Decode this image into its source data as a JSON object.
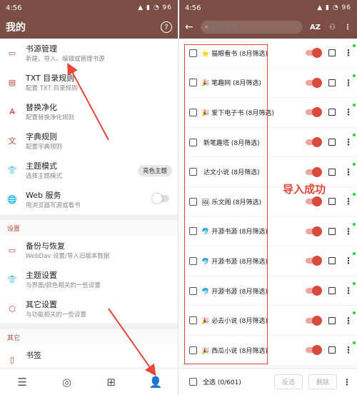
{
  "left": {
    "status_time": "4:56",
    "status_icons": "▲ ▮ ◔ 96",
    "title": "我的",
    "help": "?",
    "items": [
      {
        "title": "书源管理",
        "sub": "新建、导入、编辑或管理书源",
        "icon": "book-icon",
        "glyph": "▭"
      },
      {
        "title": "TXT 目录规则",
        "sub": "配置 TXT 目录规则",
        "icon": "txt-rule-icon",
        "glyph": "▤"
      },
      {
        "title": "替换净化",
        "sub": "配置替换净化规则",
        "icon": "replace-icon",
        "glyph": "A̶"
      },
      {
        "title": "字典规则",
        "sub": "配置字典规则",
        "icon": "dictionary-icon",
        "glyph": "文"
      },
      {
        "title": "主题模式",
        "sub": "选择主题模式",
        "icon": "theme-mode-icon",
        "glyph": "👕",
        "pill": "亮色主题"
      },
      {
        "title": "Web 服务",
        "sub": "用浏览器写源或看书",
        "icon": "globe-icon",
        "glyph": "🌐"
      }
    ],
    "section_settings": "设置",
    "settings_items": [
      {
        "title": "备份与恢复",
        "sub": "WebDav 设置/导入旧版本数据",
        "icon": "folder-icon",
        "glyph": "▭"
      },
      {
        "title": "主题设置",
        "sub": "与界面/颜色相关的一些设置",
        "icon": "palette-icon",
        "glyph": "👕"
      },
      {
        "title": "其它设置",
        "sub": "与功能相关的一些设置",
        "icon": "settings-icon",
        "glyph": "⬡"
      }
    ],
    "section_other": "其它",
    "other_items": [
      {
        "title": "书签",
        "sub": "",
        "icon": "bookmark-icon",
        "glyph": "▯"
      }
    ]
  },
  "right": {
    "status_time": "4:56",
    "status_icons": "▲ ▮ ◔ 96",
    "search_placeholder": "搜索书源",
    "sort_icon_text": "AZ",
    "sources": [
      {
        "emoji": "⭐",
        "name": "猫眼看书 (8月筛选)"
      },
      {
        "emoji": "🎉",
        "name": "笔趣网 (8月筛选)"
      },
      {
        "emoji": "🎉",
        "name": "爱下电子书 (8月筛选)"
      },
      {
        "emoji": "",
        "name": "新笔趣塔 (8月筛选)"
      },
      {
        "emoji": "",
        "name": "达文小说 (8月筛选)"
      },
      {
        "emoji": "🖼",
        "name": "乐文阁 (8月筛选)"
      },
      {
        "emoji": "🐬",
        "name": "开源书源 (8月筛选)"
      },
      {
        "emoji": "🐬",
        "name": "开源书源 (8月筛选)"
      },
      {
        "emoji": "🐬",
        "name": "开源书源 (8月筛选)"
      },
      {
        "emoji": "🎉",
        "name": "必去小说 (8月筛选)"
      },
      {
        "emoji": "🎉",
        "name": "西瓜小说 (8月筛选)"
      }
    ],
    "select_all": "全选 (0/601)",
    "invert": "反选",
    "delete": "删除"
  },
  "annotation": "导入成功",
  "colors": {
    "appbar": "#7a4e44",
    "accent": "#d84a3a",
    "annotation": "#e5483a"
  }
}
